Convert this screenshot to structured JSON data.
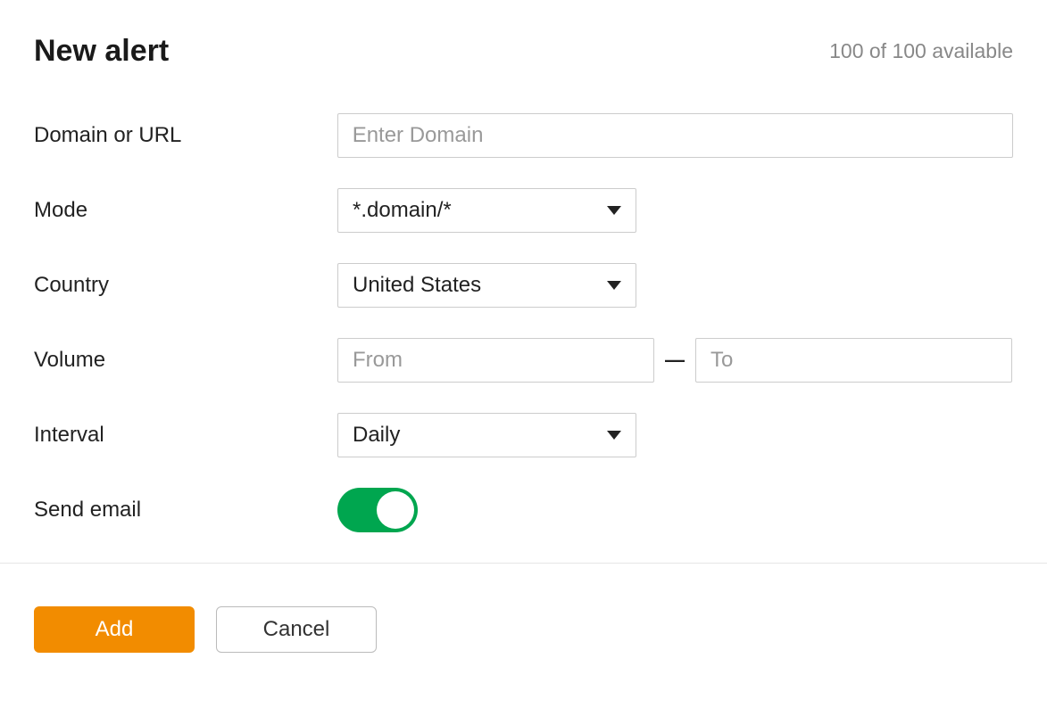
{
  "header": {
    "title": "New alert",
    "available": "100 of 100 available"
  },
  "fields": {
    "domain": {
      "label": "Domain or URL",
      "placeholder": "Enter Domain",
      "value": ""
    },
    "mode": {
      "label": "Mode",
      "value": "*.domain/*"
    },
    "country": {
      "label": "Country",
      "value": "United States"
    },
    "volume": {
      "label": "Volume",
      "from_placeholder": "From",
      "from_value": "",
      "to_placeholder": "To",
      "to_value": "",
      "separator": "—"
    },
    "interval": {
      "label": "Interval",
      "value": "Daily"
    },
    "send_email": {
      "label": "Send email",
      "enabled": true
    }
  },
  "actions": {
    "add": "Add",
    "cancel": "Cancel"
  },
  "colors": {
    "primary_button": "#f28c00",
    "toggle_on": "#00a64f"
  }
}
